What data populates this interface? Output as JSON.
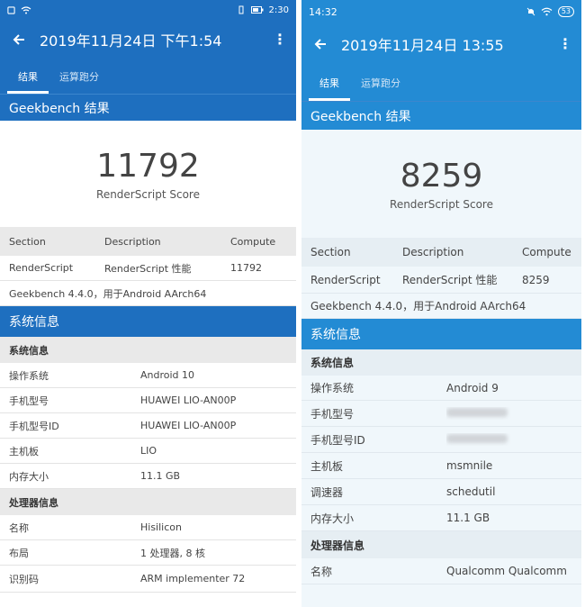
{
  "left": {
    "status": {
      "time": "2:30"
    },
    "appbar": {
      "title": "2019年11月24日 下午1:54"
    },
    "tabs": [
      {
        "label": "结果"
      },
      {
        "label": "运算跑分"
      }
    ],
    "gb_title": "Geekbench 结果",
    "score": {
      "value": "11792",
      "label": "RenderScript Score"
    },
    "table": {
      "headers": [
        "Section",
        "Description",
        "Compute"
      ],
      "row": [
        "RenderScript",
        "RenderScript 性能",
        "11792"
      ],
      "footer": "Geekbench 4.4.0，用于Android AArch64"
    },
    "sysinfo": {
      "title": "系统信息",
      "sub1": "系统信息",
      "rows": [
        {
          "k": "操作系统",
          "v": "Android 10"
        },
        {
          "k": "手机型号",
          "v": "HUAWEI LIO-AN00P"
        },
        {
          "k": "手机型号ID",
          "v": "HUAWEI LIO-AN00P"
        },
        {
          "k": "主机板",
          "v": "LIO"
        },
        {
          "k": "内存大小",
          "v": "11.1 GB"
        }
      ],
      "sub2": "处理器信息",
      "cpu_rows": [
        {
          "k": "名称",
          "v": "Hisilicon"
        },
        {
          "k": "布局",
          "v": "1 处理器, 8 核"
        },
        {
          "k": "识别码",
          "v": "ARM implementer 72"
        }
      ]
    }
  },
  "right": {
    "status": {
      "time": "14:32",
      "battery": "53"
    },
    "appbar": {
      "title": "2019年11月24日 13:55"
    },
    "tabs": [
      {
        "label": "结果"
      },
      {
        "label": "运算跑分"
      }
    ],
    "gb_title": "Geekbench 结果",
    "score": {
      "value": "8259",
      "label": "RenderScript Score"
    },
    "table": {
      "headers": [
        "Section",
        "Description",
        "Compute"
      ],
      "row": [
        "RenderScript",
        "RenderScript 性能",
        "8259"
      ],
      "footer": "Geekbench 4.4.0，用于Android AArch64"
    },
    "sysinfo": {
      "title": "系统信息",
      "sub1": "系统信息",
      "rows": [
        {
          "k": "操作系统",
          "v": "Android 9"
        },
        {
          "k": "手机型号",
          "v": ""
        },
        {
          "k": "手机型号ID",
          "v": ""
        },
        {
          "k": "主机板",
          "v": "msmnile"
        },
        {
          "k": "调速器",
          "v": "schedutil"
        },
        {
          "k": "内存大小",
          "v": "11.1 GB"
        }
      ],
      "sub2": "处理器信息",
      "cpu_rows": [
        {
          "k": "名称",
          "v": "Qualcomm Qualcomm"
        }
      ]
    }
  }
}
